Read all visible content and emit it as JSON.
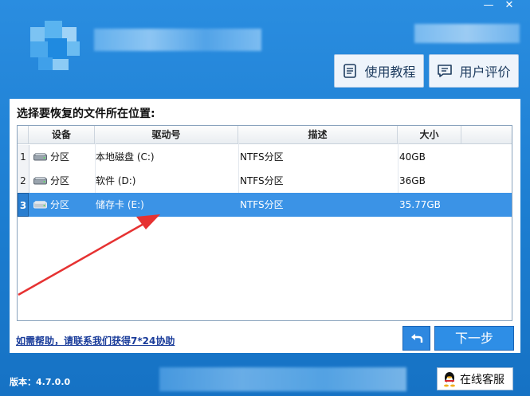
{
  "window": {
    "minimize_glyph": "—",
    "close_glyph": "✕"
  },
  "header": {
    "tutorial_label": "使用教程",
    "review_label": "用户评价"
  },
  "panel": {
    "title": "选择要恢复的文件所在位置:",
    "columns": [
      "设备",
      "驱动号",
      "描述",
      "大小"
    ],
    "rows": [
      {
        "num": "1",
        "device": "分区",
        "drive": "本地磁盘 (C:)",
        "desc": "NTFS分区",
        "size": "40GB",
        "selected": false
      },
      {
        "num": "2",
        "device": "分区",
        "drive": "软件 (D:)",
        "desc": "NTFS分区",
        "size": "36GB",
        "selected": false
      },
      {
        "num": "3",
        "device": "分区",
        "drive": "储存卡 (E:)",
        "desc": "NTFS分区",
        "size": "35.77GB",
        "selected": true
      }
    ]
  },
  "footer": {
    "help_link": "如需帮助，请联系我们获得7*24协助",
    "next_label": "下一步",
    "version": "版本：4.7.0.0",
    "service_label": "在线客服"
  },
  "colors": {
    "accent": "#2a8de0",
    "selected_row": "#3b93e6",
    "arrow": "#e63232"
  },
  "icons": [
    "document-icon",
    "comment-icon",
    "disk-icon",
    "back-arrow-icon",
    "qq-penguin-icon"
  ]
}
